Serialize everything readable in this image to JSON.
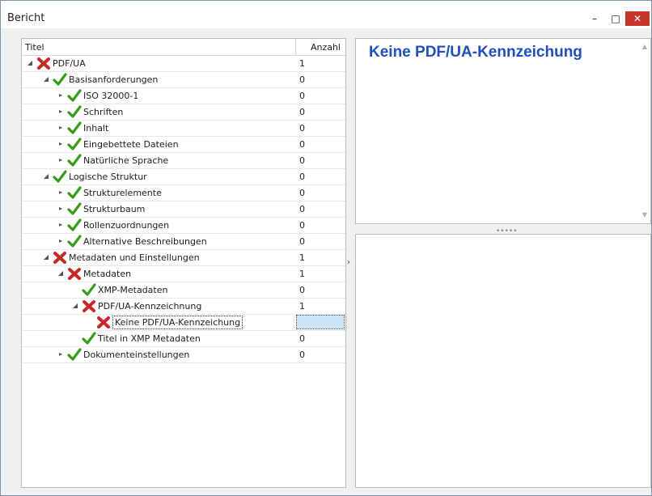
{
  "window": {
    "title": "Bericht"
  },
  "controls": {
    "minimize": "–",
    "maximize": "□",
    "close": "✕"
  },
  "tree": {
    "columns": {
      "title": "Titel",
      "count": "Anzahl"
    },
    "rows": [
      {
        "label": "PDF/UA",
        "count": "1",
        "status": "error",
        "level": 0,
        "expander": "open"
      },
      {
        "label": "Basisanforderungen",
        "count": "0",
        "status": "ok",
        "level": 1,
        "expander": "open"
      },
      {
        "label": "ISO 32000-1",
        "count": "0",
        "status": "ok",
        "level": 2,
        "expander": "closed"
      },
      {
        "label": "Schriften",
        "count": "0",
        "status": "ok",
        "level": 2,
        "expander": "closed"
      },
      {
        "label": "Inhalt",
        "count": "0",
        "status": "ok",
        "level": 2,
        "expander": "closed"
      },
      {
        "label": "Eingebettete Dateien",
        "count": "0",
        "status": "ok",
        "level": 2,
        "expander": "closed"
      },
      {
        "label": "Natürliche Sprache",
        "count": "0",
        "status": "ok",
        "level": 2,
        "expander": "closed"
      },
      {
        "label": "Logische Struktur",
        "count": "0",
        "status": "ok",
        "level": 1,
        "expander": "open"
      },
      {
        "label": "Strukturelemente",
        "count": "0",
        "status": "ok",
        "level": 2,
        "expander": "closed"
      },
      {
        "label": "Strukturbaum",
        "count": "0",
        "status": "ok",
        "level": 2,
        "expander": "closed"
      },
      {
        "label": "Rollenzuordnungen",
        "count": "0",
        "status": "ok",
        "level": 2,
        "expander": "closed"
      },
      {
        "label": "Alternative Beschreibungen",
        "count": "0",
        "status": "ok",
        "level": 2,
        "expander": "closed"
      },
      {
        "label": "Metadaten und Einstellungen",
        "count": "1",
        "status": "error",
        "level": 1,
        "expander": "open"
      },
      {
        "label": "Metadaten",
        "count": "1",
        "status": "error",
        "level": 2,
        "expander": "open"
      },
      {
        "label": "XMP-Metadaten",
        "count": "0",
        "status": "ok",
        "level": 3,
        "expander": "none"
      },
      {
        "label": "PDF/UA-Kennzeichnung",
        "count": "1",
        "status": "error",
        "level": 3,
        "expander": "open"
      },
      {
        "label": "Keine PDF/UA-Kennzeichung",
        "count": "",
        "status": "error",
        "level": 4,
        "expander": "none",
        "selected": true
      },
      {
        "label": "Titel in XMP Metadaten",
        "count": "0",
        "status": "ok",
        "level": 3,
        "expander": "none"
      },
      {
        "label": "Dokumenteinstellungen",
        "count": "0",
        "status": "ok",
        "level": 2,
        "expander": "closed"
      }
    ]
  },
  "detail": {
    "heading": "Keine PDF/UA-Kennzeichung"
  },
  "colors": {
    "heading": "#1f4fbf",
    "ok": "#3a9a1c",
    "error": "#c62828",
    "selection": "#cce4f7"
  },
  "icons": {
    "ok": "check-icon",
    "error": "error-cross-icon",
    "expanded": "triangle-down-icon",
    "collapsed": "triangle-right-icon"
  }
}
